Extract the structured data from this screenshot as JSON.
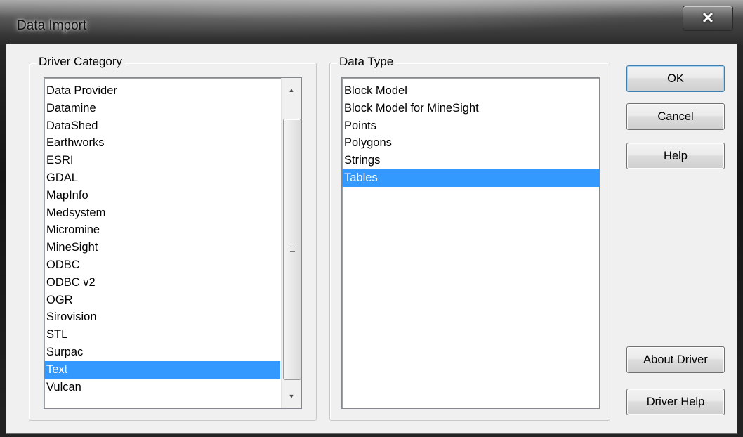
{
  "window": {
    "title": "Data Import",
    "close_glyph": "✕"
  },
  "driver_category": {
    "label": "Driver Category",
    "items": [
      {
        "label": "Data Provider"
      },
      {
        "label": "Datamine"
      },
      {
        "label": "DataShed"
      },
      {
        "label": "Earthworks"
      },
      {
        "label": "ESRI"
      },
      {
        "label": "GDAL"
      },
      {
        "label": "MapInfo"
      },
      {
        "label": "Medsystem"
      },
      {
        "label": "Micromine"
      },
      {
        "label": "MineSight"
      },
      {
        "label": "ODBC"
      },
      {
        "label": "ODBC v2"
      },
      {
        "label": "OGR"
      },
      {
        "label": "Sirovision"
      },
      {
        "label": "STL"
      },
      {
        "label": "Surpac"
      },
      {
        "label": "Text"
      },
      {
        "label": "Vulcan"
      }
    ],
    "selected": "Text"
  },
  "data_type": {
    "label": "Data Type",
    "items": [
      {
        "label": "Block Model"
      },
      {
        "label": "Block Model for MineSight"
      },
      {
        "label": "Points"
      },
      {
        "label": "Polygons"
      },
      {
        "label": "Strings"
      },
      {
        "label": "Tables"
      }
    ],
    "selected": "Tables"
  },
  "buttons": {
    "ok": "OK",
    "cancel": "Cancel",
    "help": "Help",
    "about_driver": "About Driver",
    "driver_help": "Driver Help"
  },
  "colors": {
    "selection": "#3399ff",
    "dialog_bg": "#f0f0f0"
  }
}
